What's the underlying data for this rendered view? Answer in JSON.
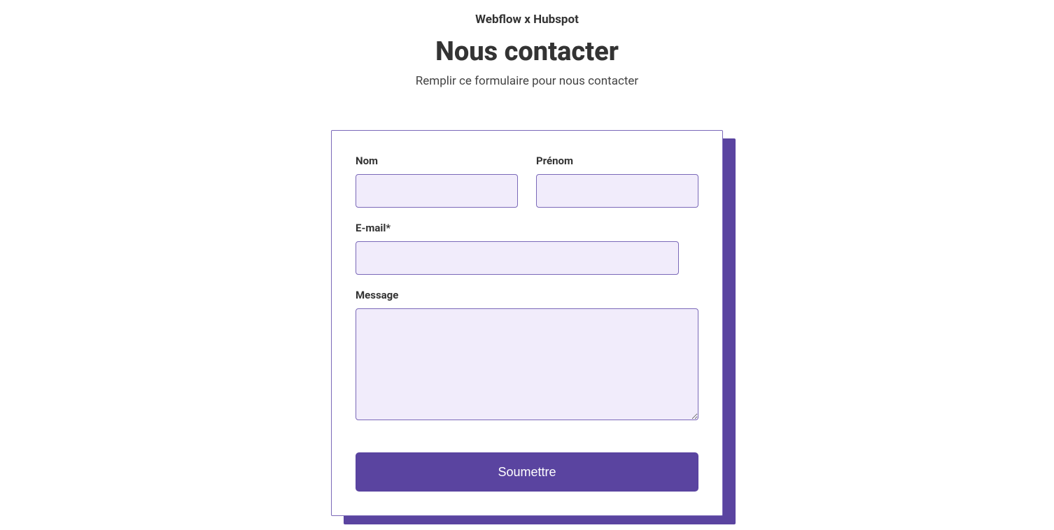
{
  "header": {
    "eyebrow": "Webflow x Hubspot",
    "title": "Nous contacter",
    "subtitle": "Remplir ce formulaire pour nous contacter"
  },
  "form": {
    "fields": {
      "nom": {
        "label": "Nom",
        "value": ""
      },
      "prenom": {
        "label": "Prénom",
        "value": ""
      },
      "email": {
        "label": "E-mail*",
        "value": ""
      },
      "message": {
        "label": "Message",
        "value": ""
      }
    },
    "submit_label": "Soumettre"
  },
  "colors": {
    "accent": "#5a44a0",
    "input_bg": "#f1ecfb",
    "input_border": "#7a68b8"
  }
}
